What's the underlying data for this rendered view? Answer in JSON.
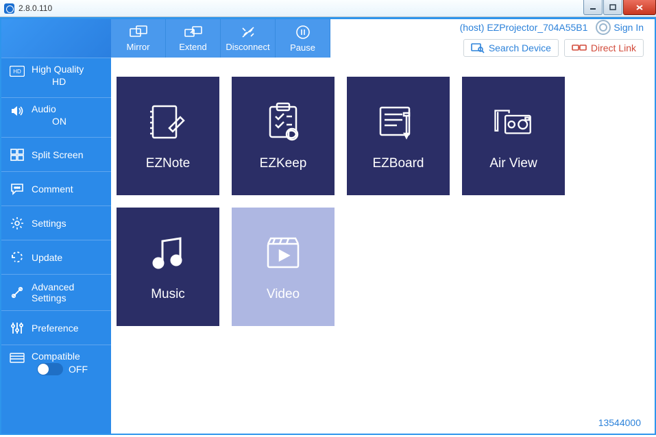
{
  "window": {
    "title": "2.8.0.110"
  },
  "sidebar": {
    "highQuality": {
      "label": "High Quality",
      "value": "HD"
    },
    "audio": {
      "label": "Audio",
      "value": "ON"
    },
    "splitScreen": {
      "label": "Split Screen"
    },
    "comment": {
      "label": "Comment"
    },
    "settings": {
      "label": "Settings"
    },
    "update": {
      "label": "Update"
    },
    "advanced": {
      "label": "Advanced Settings"
    },
    "preference": {
      "label": "Preference"
    },
    "compatible": {
      "label": "Compatible",
      "value": "OFF"
    }
  },
  "topbar": {
    "mirror": "Mirror",
    "extend": "Extend",
    "disconnect": "Disconnect",
    "pause": "Pause"
  },
  "header": {
    "hostLabel": "(host) EZProjector_704A55B1",
    "signIn": "Sign In",
    "searchDevice": "Search Device",
    "directLink": "Direct Link"
  },
  "tiles": {
    "eznote": "EZNote",
    "ezkeep": "EZKeep",
    "ezboard": "EZBoard",
    "airview": "Air View",
    "music": "Music",
    "video": "Video"
  },
  "footer": {
    "number": "13544000"
  }
}
